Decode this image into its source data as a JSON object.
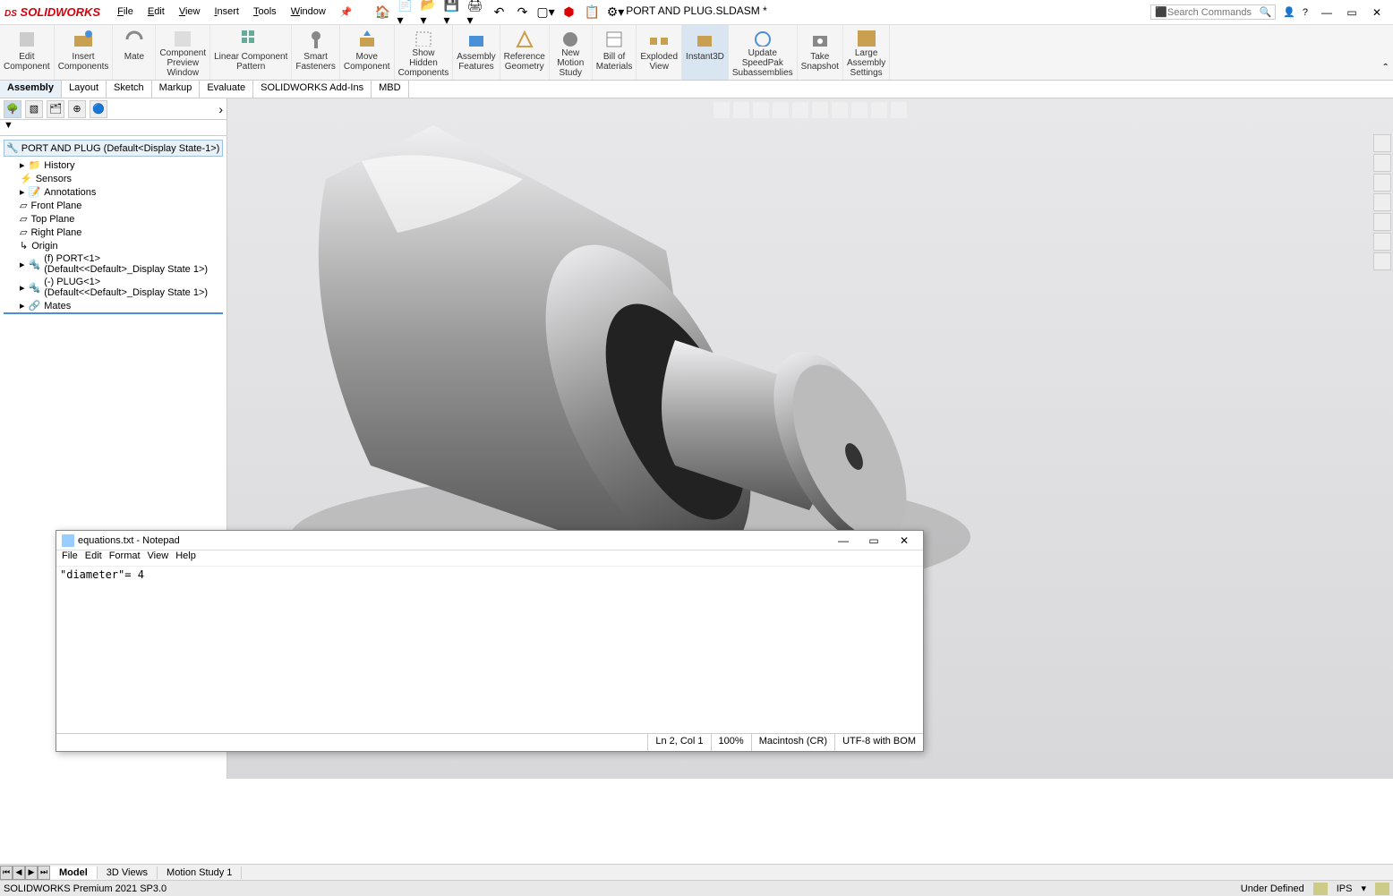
{
  "app": {
    "logo": "SOLIDWORKS",
    "title": "PORT AND PLUG.SLDASM *",
    "search_placeholder": "Search Commands"
  },
  "menu": {
    "file": "File",
    "edit": "Edit",
    "view": "View",
    "insert": "Insert",
    "tools": "Tools",
    "window": "Window"
  },
  "ribbon": {
    "edit_component": "Edit\nComponent",
    "insert_components": "Insert\nComponents",
    "mate": "Mate",
    "component_preview": "Component\nPreview\nWindow",
    "linear_pattern": "Linear Component\nPattern",
    "smart_fasteners": "Smart\nFasteners",
    "move_component": "Move\nComponent",
    "show_hidden": "Show\nHidden\nComponents",
    "assembly_features": "Assembly\nFeatures",
    "reference_geometry": "Reference\nGeometry",
    "new_motion": "New\nMotion\nStudy",
    "bom": "Bill of\nMaterials",
    "exploded": "Exploded\nView",
    "instant3d": "Instant3D",
    "update_speedpak": "Update\nSpeedPak\nSubassemblies",
    "take_snapshot": "Take\nSnapshot",
    "large_assembly": "Large\nAssembly\nSettings"
  },
  "tabs": {
    "assembly": "Assembly",
    "layout": "Layout",
    "sketch": "Sketch",
    "markup": "Markup",
    "evaluate": "Evaluate",
    "addins": "SOLIDWORKS Add-Ins",
    "mbd": "MBD"
  },
  "tree": {
    "root": "PORT AND PLUG  (Default<Display State-1>)",
    "history": "History",
    "sensors": "Sensors",
    "annotations": "Annotations",
    "front_plane": "Front Plane",
    "top_plane": "Top Plane",
    "right_plane": "Right Plane",
    "origin": "Origin",
    "port": "(f) PORT<1> (Default<<Default>_Display State 1>)",
    "plug": "(-) PLUG<1> (Default<<Default>_Display State 1>)",
    "mates": "Mates"
  },
  "notepad": {
    "title": "equations.txt - Notepad",
    "menu_file": "File",
    "menu_edit": "Edit",
    "menu_format": "Format",
    "menu_view": "View",
    "menu_help": "Help",
    "content": "\"diameter\"= 4",
    "status_pos": "Ln 2, Col 1",
    "status_zoom": "100%",
    "status_eol": "Macintosh (CR)",
    "status_enc": "UTF-8 with BOM"
  },
  "bottom_tabs": {
    "model": "Model",
    "views3d": "3D Views",
    "motion": "Motion Study 1"
  },
  "statusbar": {
    "left": "SOLIDWORKS Premium 2021 SP3.0",
    "under_defined": "Under Defined",
    "units": "IPS"
  }
}
